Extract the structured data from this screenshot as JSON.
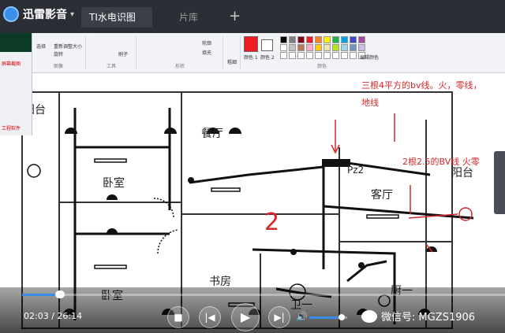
{
  "app": {
    "name": "迅雷影音",
    "menu_arrow": "▾"
  },
  "tabs": [
    {
      "label": "TI水电识图安"
    },
    {
      "label": "片库"
    }
  ],
  "new_tab": "+",
  "ribbon": {
    "groups": [
      "图像",
      "工具",
      "形状",
      "颜色"
    ],
    "items": {
      "select": "选择",
      "resize": "重新调整大小",
      "rotate": "旋转",
      "brushes": "刷子",
      "outline": "轮廓",
      "fill": "填充",
      "size": "粗细",
      "color1": "颜色 1",
      "color2": "颜色 2",
      "edit_colors": "编辑颜色"
    },
    "palette": [
      "#000000",
      "#7f7f7f",
      "#880015",
      "#ed1c24",
      "#ff7f27",
      "#fff200",
      "#22b14c",
      "#00a2e8",
      "#3f48cc",
      "#a349a4",
      "#ffffff",
      "#c3c3c3",
      "#b97a57",
      "#ffaec9",
      "#ffc90e",
      "#efe4b0",
      "#b5e61d",
      "#99d9ea",
      "#7092be",
      "#c8bfe7",
      "#ffffff",
      "#ffffff",
      "#ffffff",
      "#ffffff",
      "#ffffff",
      "#ffffff",
      "#ffffff",
      "#ffffff",
      "#ffffff",
      "#ffffff"
    ]
  },
  "side_panel": {
    "caption": "屏幕截图",
    "footer": "工程软件"
  },
  "annotations": [
    {
      "text": "三根4平方的bv线。火，零线，"
    },
    {
      "text": "地线"
    },
    {
      "text": "2根2.5的BV线 火零"
    },
    {
      "text": "2"
    }
  ],
  "rooms": [
    "阳台",
    "卧室",
    "餐厅",
    "卧室",
    "书房",
    "客厅",
    "阳台",
    "厨一",
    "卫一",
    "Pz2"
  ],
  "player": {
    "current_time": "02:03",
    "total_time": "26:14",
    "time_sep": " / ",
    "progress": 0.079,
    "volume": 0.85
  },
  "watermark": "微信号: MGZS1906"
}
